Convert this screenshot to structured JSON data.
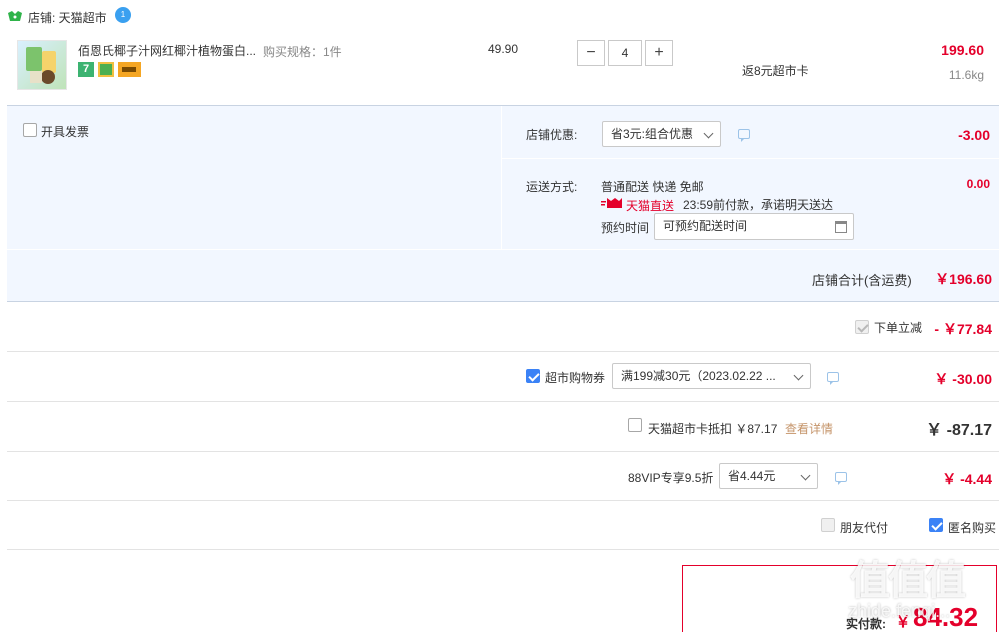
{
  "shop": {
    "label": "店铺: 天猫超市",
    "badge_count": "1"
  },
  "item": {
    "title": "佰恩氏椰子汁网红椰汁植物蛋白...",
    "spec": "购买规格：1件",
    "unit_price": "49.90",
    "quantity": "4",
    "cashback": "返8元超市卡",
    "total": "199.60",
    "weight": "11.6kg"
  },
  "invoice": {
    "label": "开具发票"
  },
  "discount": {
    "label": "店铺优惠:",
    "selected": "省3元:组合优惠",
    "amount": "-3.00"
  },
  "shipping": {
    "label": "运送方式:",
    "method": "普通配送 快递 免邮",
    "amount": "0.00",
    "tmall_badge": "天猫直送",
    "promise": "23:59前付款，承诺明天送达",
    "schedule_label": "预约时间",
    "schedule_value": "可预约配送时间"
  },
  "shop_total": {
    "label": "店铺合计(含运费)",
    "amount": "￥196.60"
  },
  "instant_discount": {
    "label": "下单立减",
    "amount": "- ￥77.84"
  },
  "coupon": {
    "label": "超市购物券",
    "selected": "满199减30元（2023.02.22 ...",
    "amount": "￥ -30.00"
  },
  "card": {
    "label": "天猫超市卡抵扣 ￥87.17",
    "details_link": "查看详情",
    "amount": "￥ -87.17"
  },
  "vip": {
    "label": "88VIP专享9.5折",
    "selected": "省4.44元",
    "amount": "￥ -4.44"
  },
  "options": {
    "friend_pay": "朋友代付",
    "anonymous": "匿名购买"
  },
  "payment": {
    "label": "实付款:",
    "currency": "￥",
    "amount": "84.32"
  },
  "watermark": {
    "text": "值值值",
    "sub": "zhide.fenqi..."
  },
  "colors": {
    "accent_red": "#e4002b",
    "blue_bg": "#f2f7ff",
    "check_blue": "#3b82f6",
    "link_brown": "#c5946a"
  }
}
